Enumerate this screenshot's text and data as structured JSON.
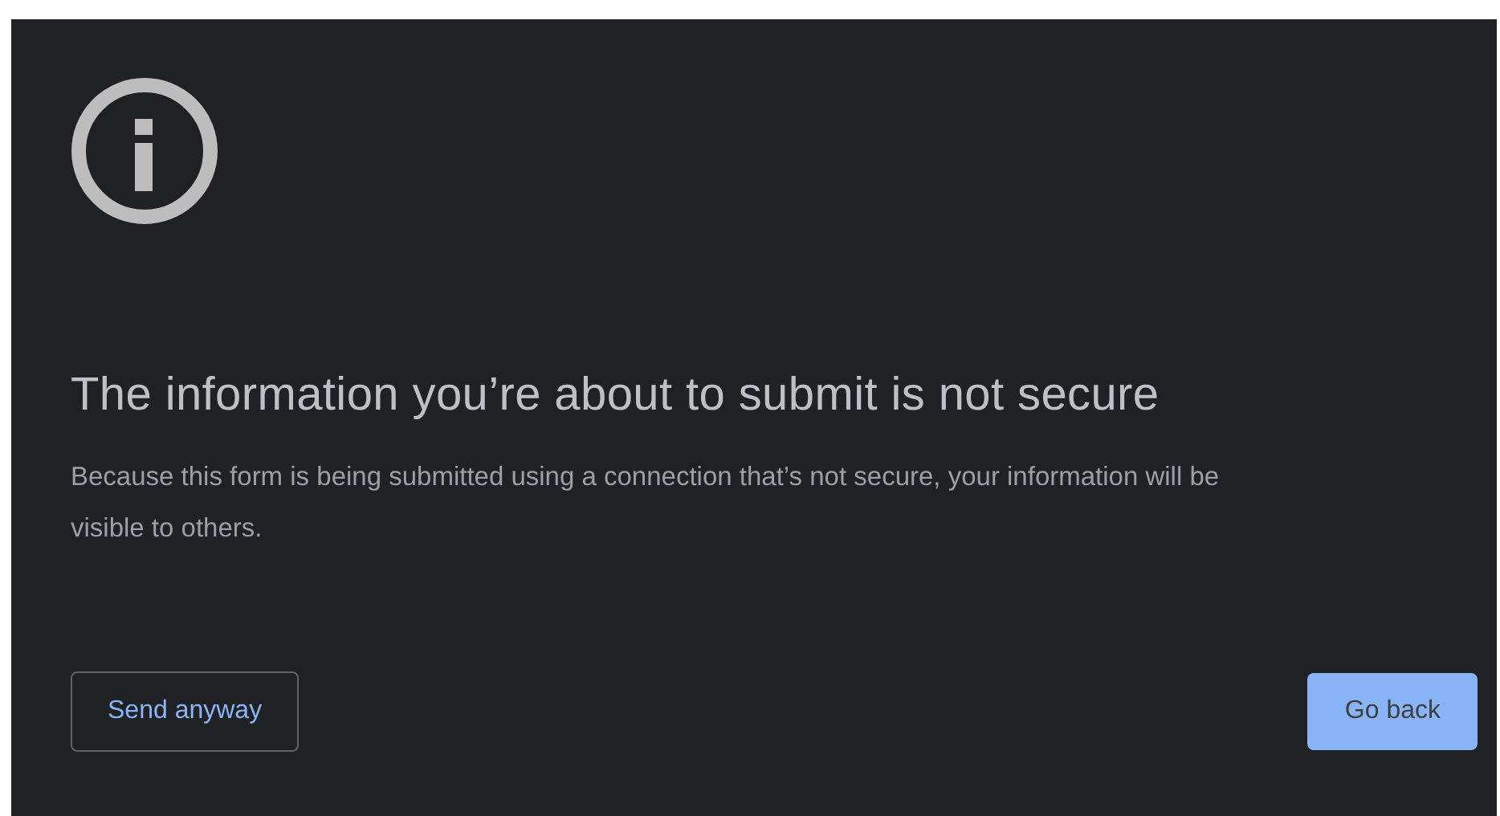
{
  "title": "The information you’re about to submit is not secure",
  "message": "Because this form is being submitted using a connection that’s not secure, your information will be visible to others.",
  "buttons": [
    {
      "label": "Send anyway",
      "kind": "secondary"
    },
    {
      "label": "Go back",
      "kind": "primary"
    }
  ]
}
